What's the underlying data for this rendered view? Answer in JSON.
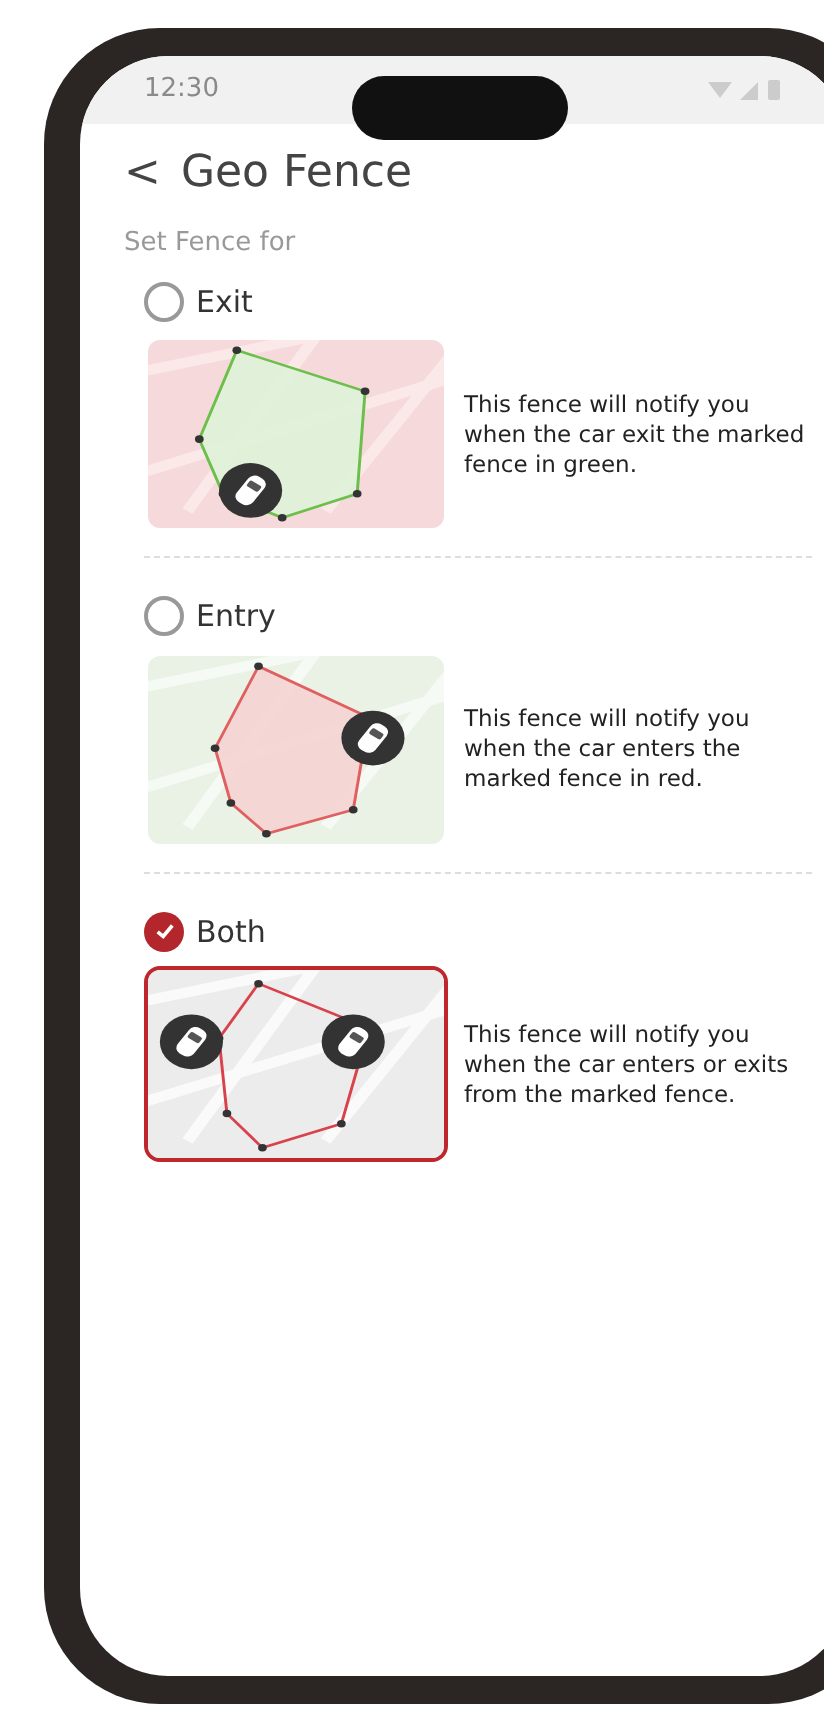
{
  "status_bar": {
    "time": "12:30"
  },
  "header": {
    "back": "<",
    "title": "Geo Fence"
  },
  "section_label": "Set Fence for",
  "options": [
    {
      "kind": "exit",
      "label": "Exit",
      "selected": false,
      "description": "This fence will notify you when the car exit the marked fence in green."
    },
    {
      "kind": "entry",
      "label": "Entry",
      "selected": false,
      "description": "This fence will notify you when the car enters the marked fence in red."
    },
    {
      "kind": "both",
      "label": "Both",
      "selected": true,
      "description": "This fence will notify you when the car enters or exits from the marked fence."
    }
  ]
}
